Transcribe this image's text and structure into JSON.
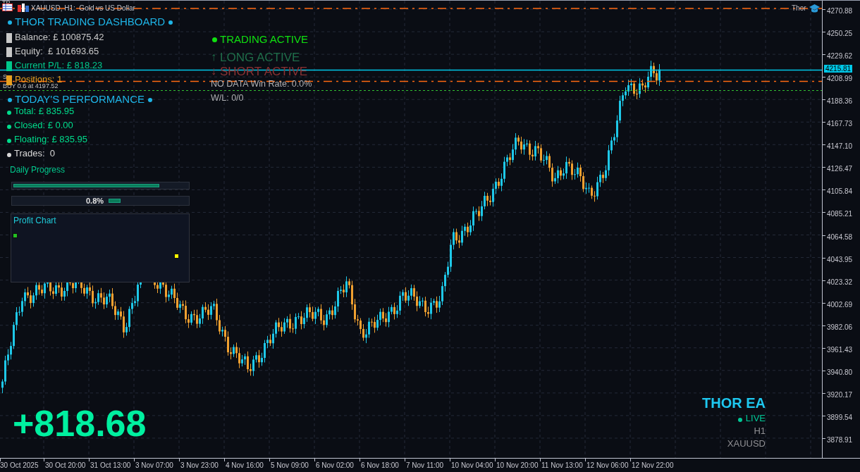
{
  "window": {
    "title": "XAUUSD, H1:  Gold vs US Dollar"
  },
  "chart_labels": {
    "tp": "TP",
    "sl": "S",
    "order": "BUY 0.6 at 4197.52",
    "ea_name": "Thor"
  },
  "price_axis": [
    "4270.88",
    "4250.25",
    "4229.62",
    "4208.99",
    "4188.36",
    "4167.73",
    "4147.10",
    "4126.47",
    "4105.84",
    "4085.21",
    "4064.58",
    "4043.95",
    "4023.32",
    "4002.69",
    "3982.06",
    "3961.43",
    "3940.80",
    "3920.17",
    "3899.54",
    "3878.91"
  ],
  "current_price": "4215.81",
  "time_axis": [
    "30 Oct 2025",
    "30 Oct 20:00",
    "31 Oct 13:00",
    "3 Nov 07:00",
    "3 Nov 23:00",
    "4 Nov 16:00",
    "5 Nov 09:00",
    "6 Nov 02:00",
    "6 Nov 18:00",
    "7 Nov 11:00",
    "10 Nov 04:00",
    "10 Nov 20:00",
    "11 Nov 13:00",
    "12 Nov 06:00",
    "12 Nov 22:00"
  ],
  "dashboard": {
    "title": "THOR TRADING DASHBOARD",
    "stats": [
      {
        "label": "Balance: £ 100875.42",
        "color": "#c8c8c8"
      },
      {
        "label": "Equity:  £ 101693.65",
        "color": "#c8c8c8"
      },
      {
        "label": "Current P/L: £ 818.23",
        "color": "#00c88c"
      },
      {
        "label": "Positions: 1",
        "color": "#e8a020"
      }
    ],
    "performance_title": "TODAY'S PERFORMANCE",
    "performance": [
      {
        "label": "Total: £ 835.95",
        "color": "#00dc8c"
      },
      {
        "label": "Closed: £ 0.00",
        "color": "#00dc8c"
      },
      {
        "label": "Floating: £ 835.95",
        "color": "#00dc8c"
      },
      {
        "label": "Trades:  0",
        "color": "#d8d8d8"
      }
    ]
  },
  "status": {
    "trading": "TRADING ACTIVE",
    "long": {
      "arrow": "↑",
      "label": "LONG ACTIVE",
      "on": false
    },
    "short": {
      "arrow": "↓",
      "label": "SHORT ACTIVE",
      "on": false
    },
    "win_rate": "NO DATA Win Rate: 0.0%",
    "wl": "W/L: 0/0"
  },
  "progress": {
    "title": "Daily Progress",
    "level": 0.83
  },
  "target": {
    "reading": "0.8%"
  },
  "profit_chart": {
    "title": "Profit Chart",
    "points": [
      {
        "color": "#22c022"
      },
      {
        "color": "#ffff00"
      }
    ]
  },
  "pnl_big": "+818.68",
  "badge": {
    "title": "THOR EA",
    "live": "LIVE",
    "timeframe": "H1",
    "symbol": "XAUUSD"
  }
}
